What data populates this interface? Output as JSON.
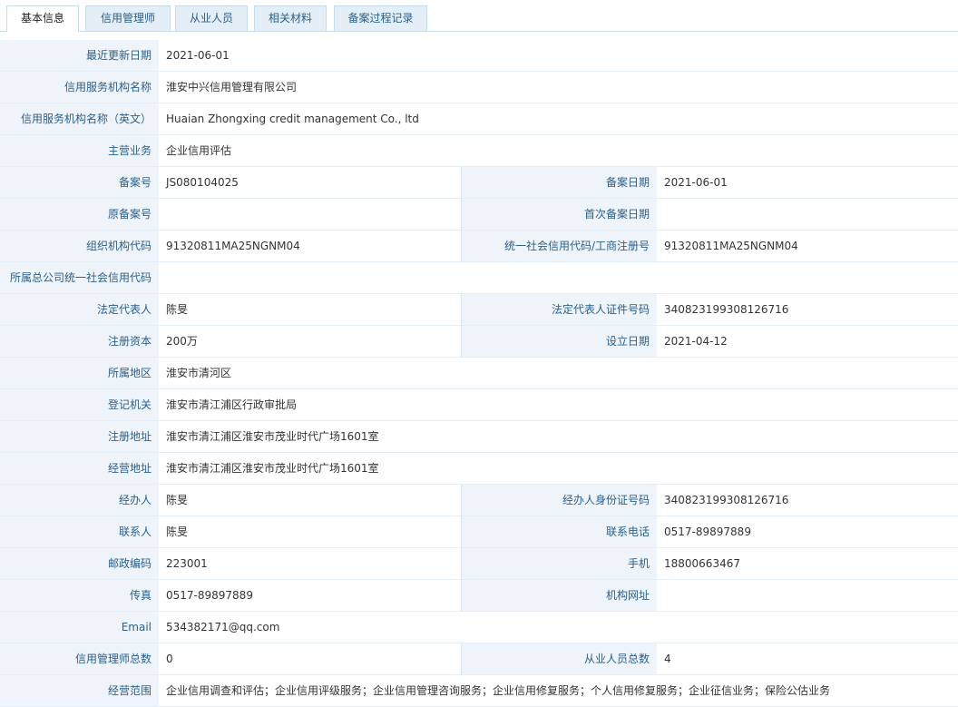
{
  "tabs": [
    {
      "label": "基本信息",
      "active": true
    },
    {
      "label": "信用管理师",
      "active": false
    },
    {
      "label": "从业人员",
      "active": false
    },
    {
      "label": "相关材料",
      "active": false
    },
    {
      "label": "备案过程记录",
      "active": false
    }
  ],
  "info": {
    "last_updated": {
      "label": "最近更新日期",
      "value": "2021-06-01"
    },
    "org_name": {
      "label": "信用服务机构名称",
      "value": "淮安中兴信用管理有限公司"
    },
    "org_name_en": {
      "label": "信用服务机构名称（英文）",
      "value": "Huaian Zhongxing credit management Co., ltd"
    },
    "main_business": {
      "label": "主营业务",
      "value": "企业信用评估"
    },
    "record_no": {
      "label": "备案号",
      "value": "JS080104025"
    },
    "record_date": {
      "label": "备案日期",
      "value": "2021-06-01"
    },
    "original_record_no": {
      "label": "原备案号",
      "value": ""
    },
    "first_record_date": {
      "label": "首次备案日期",
      "value": ""
    },
    "org_code": {
      "label": "组织机构代码",
      "value": "91320811MA25NGNM04"
    },
    "credit_code": {
      "label": "统一社会信用代码/工商注册号",
      "value": "91320811MA25NGNM04"
    },
    "hq_credit_code": {
      "label": "所属总公司统一社会信用代码",
      "value": ""
    },
    "legal_rep": {
      "label": "法定代表人",
      "value": "陈旻"
    },
    "legal_rep_id": {
      "label": "法定代表人证件号码",
      "value": "340823199308126716"
    },
    "registered_capital": {
      "label": "注册资本",
      "value": "200万"
    },
    "established_date": {
      "label": "设立日期",
      "value": "2021-04-12"
    },
    "region": {
      "label": "所属地区",
      "value": "淮安市清河区"
    },
    "registration_authority": {
      "label": "登记机关",
      "value": "淮安市清江浦区行政审批局"
    },
    "registered_address": {
      "label": "注册地址",
      "value": "淮安市清江浦区淮安市茂业时代广场1601室"
    },
    "business_address": {
      "label": "经营地址",
      "value": "淮安市清江浦区淮安市茂业时代广场1601室"
    },
    "handler": {
      "label": "经办人",
      "value": "陈旻"
    },
    "handler_id": {
      "label": "经办人身份证号码",
      "value": "340823199308126716"
    },
    "contact": {
      "label": "联系人",
      "value": "陈旻"
    },
    "contact_phone": {
      "label": "联系电话",
      "value": "0517-89897889"
    },
    "postal_code": {
      "label": "邮政编码",
      "value": "223001"
    },
    "mobile": {
      "label": "手机",
      "value": "18800663467"
    },
    "fax": {
      "label": "传真",
      "value": "0517-89897889"
    },
    "website": {
      "label": "机构网址",
      "value": ""
    },
    "email": {
      "label": "Email",
      "value": "534382171@qq.com"
    },
    "credit_manager_count": {
      "label": "信用管理师总数",
      "value": "0"
    },
    "staff_count": {
      "label": "从业人员总数",
      "value": "4"
    },
    "business_scope": {
      "label": "经营范围",
      "value": "企业信用调查和评估；企业信用评级服务；企业信用管理咨询服务；企业信用修复服务；个人信用修复服务；企业征信业务；保险公估业务"
    }
  }
}
